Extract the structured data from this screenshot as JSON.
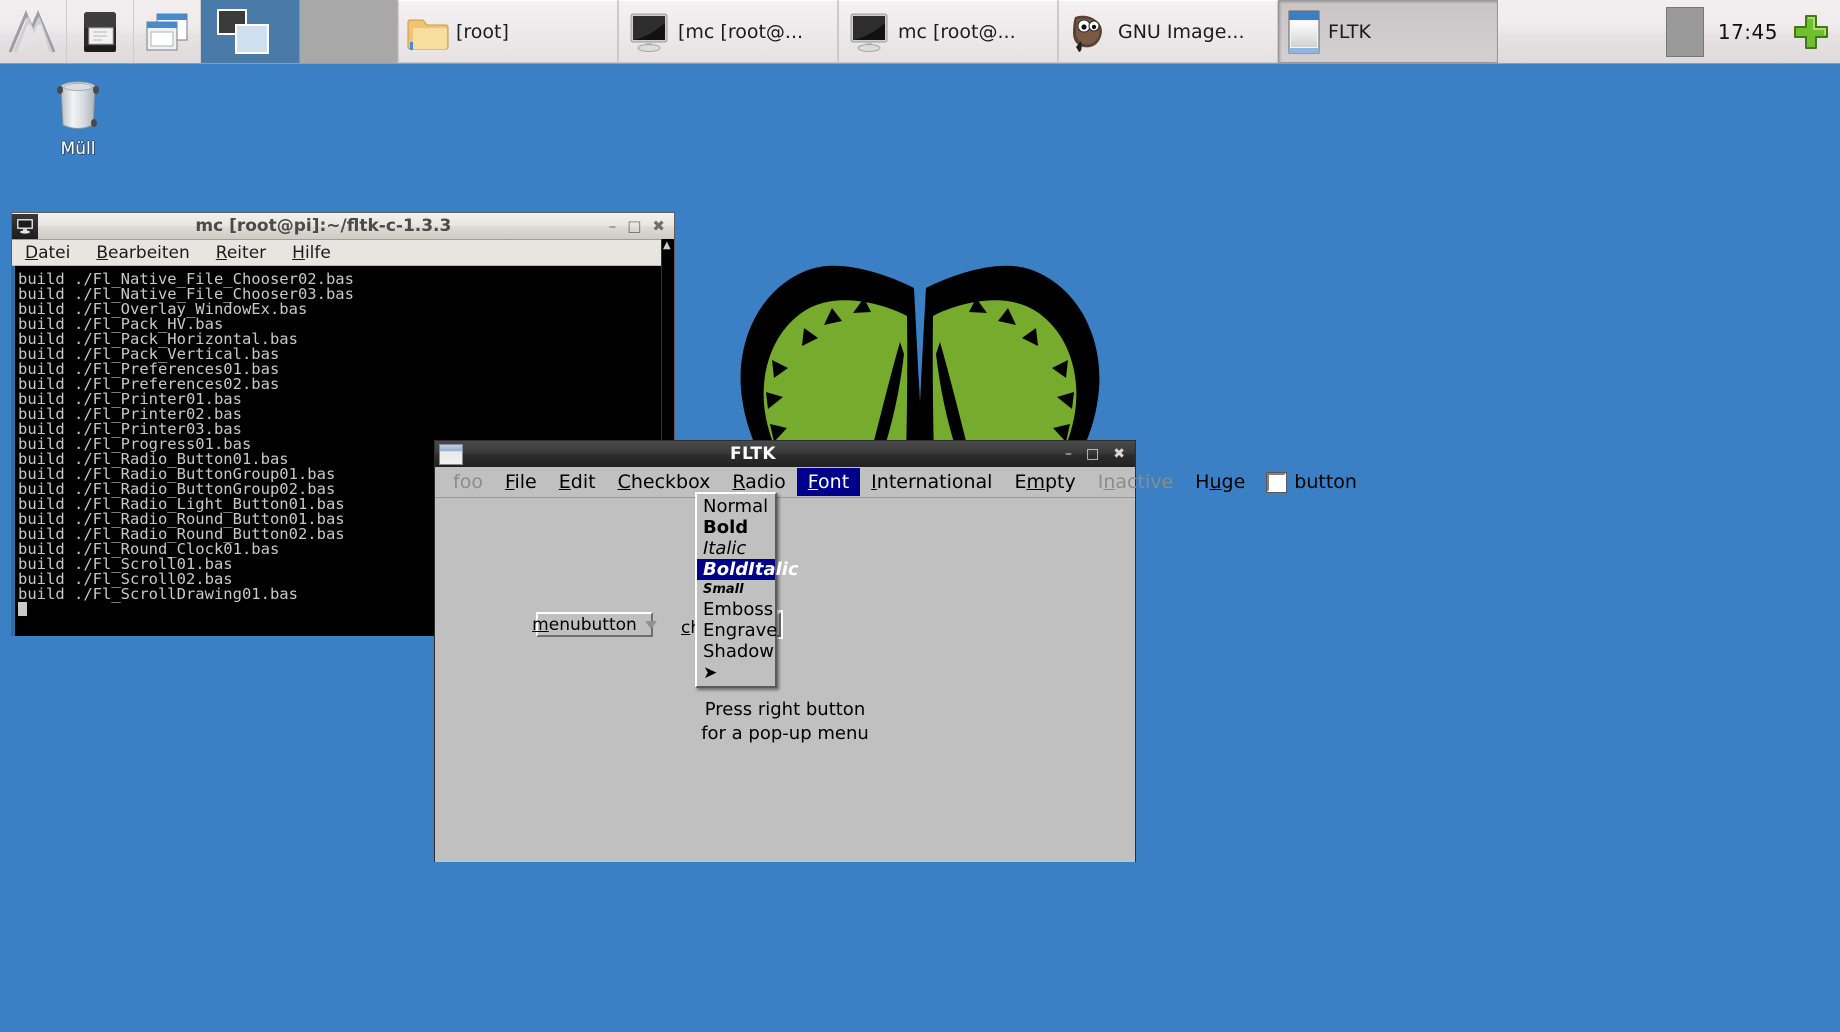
{
  "taskbar": {
    "launchers": [
      {
        "name": "xpaint-icon",
        "title": "XPaint"
      },
      {
        "name": "printer-icon",
        "title": "Printer"
      },
      {
        "name": "windows-icon",
        "title": "Windows"
      }
    ],
    "pager": {
      "active_desktop": 1,
      "desktops": 2
    },
    "tasks": [
      {
        "label": "[root]",
        "icon": "folder-icon",
        "state": "raised"
      },
      {
        "label": "[mc [root@...",
        "icon": "monitor-icon",
        "state": "raised"
      },
      {
        "label": "mc [root@...",
        "icon": "monitor-icon",
        "state": "raised"
      },
      {
        "label": "GNU Image...",
        "icon": "gimp-icon",
        "state": "raised"
      },
      {
        "label": "FLTK",
        "icon": "fltk-window-icon",
        "state": "pressed"
      }
    ],
    "clock": "17:45",
    "tray_add_icon": "green-plus-icon"
  },
  "desktop": {
    "background_color": "#3b80c4",
    "icons": [
      {
        "name": "trash-icon",
        "label": "Müll"
      }
    ],
    "wallpaper_logo": "two-green-leaves"
  },
  "mc_window": {
    "title": "mc [root@pi]:~/fltk-c-1.3.3",
    "icon": "terminal-icon",
    "window_buttons": [
      "minimize",
      "maximize",
      "close"
    ],
    "menu": [
      "Datei",
      "Bearbeiten",
      "Reiter",
      "Hilfe"
    ],
    "terminal_lines": [
      "build ./Fl_Native_File_Chooser02.bas",
      "build ./Fl_Native_File_Chooser03.bas",
      "build ./Fl_Overlay_WindowEx.bas",
      "build ./Fl_Pack_HV.bas",
      "build ./Fl_Pack_Horizontal.bas",
      "build ./Fl_Pack_Vertical.bas",
      "build ./Fl_Preferences01.bas",
      "build ./Fl_Preferences02.bas",
      "build ./Fl_Printer01.bas",
      "build ./Fl_Printer02.bas",
      "build ./Fl_Printer03.bas",
      "build ./Fl_Progress01.bas",
      "build ./Fl_Radio_Button01.bas",
      "build ./Fl_Radio_ButtonGroup01.bas",
      "build ./Fl_Radio_ButtonGroup02.bas",
      "build ./Fl_Radio_Light_Button01.bas",
      "build ./Fl_Radio_Round_Button01.bas",
      "build ./Fl_Radio_Round_Button02.bas",
      "build ./Fl_Round_Clock01.bas",
      "build ./Fl_Scroll01.bas",
      "build ./Fl_Scroll02.bas",
      "build ./Fl_ScrollDrawing01.bas"
    ]
  },
  "fltk_window": {
    "title": "FLTK",
    "window_buttons": [
      "minimize",
      "maximize",
      "close"
    ],
    "menubar": [
      {
        "label": "foo",
        "state": "disabled"
      },
      {
        "label": "File",
        "mnemonic": "F",
        "state": "normal"
      },
      {
        "label": "Edit",
        "mnemonic": "E",
        "state": "normal"
      },
      {
        "label": "Checkbox",
        "mnemonic": "C",
        "state": "normal"
      },
      {
        "label": "Radio",
        "mnemonic": "R",
        "state": "normal"
      },
      {
        "label": "Font",
        "mnemonic": "F",
        "state": "selected"
      },
      {
        "label": "International",
        "mnemonic": "I",
        "state": "normal"
      },
      {
        "label": "Empty",
        "mnemonic": "m",
        "state": "normal"
      },
      {
        "label": "Inactive",
        "mnemonic": "n",
        "state": "disabled"
      },
      {
        "label": "Huge",
        "mnemonic": "u",
        "state": "normal"
      },
      {
        "label": "button",
        "type": "checkbox",
        "checked": false
      }
    ],
    "menubutton": {
      "label": "menubutton",
      "mnemonic": "m"
    },
    "choice": {
      "label": "choice",
      "mnemonic": "c",
      "value": ""
    },
    "hint_line1": "Press right button",
    "hint_line2": "for a pop-up menu",
    "font_menu": {
      "items": [
        {
          "label": "Normal",
          "style": "normal",
          "selected": false
        },
        {
          "label": "Bold",
          "style": "bold",
          "selected": false
        },
        {
          "label": "Italic",
          "style": "italic",
          "selected": false
        },
        {
          "label": "BoldItalic",
          "style": "bolditalic",
          "selected": true
        },
        {
          "label": "Small",
          "style": "small",
          "selected": false
        },
        {
          "label": "Emboss",
          "style": "normal",
          "selected": false
        },
        {
          "label": "Engrave",
          "style": "normal",
          "selected": false
        },
        {
          "label": "Shadow",
          "style": "normal",
          "selected": false
        },
        {
          "label": "➤",
          "style": "arrow",
          "selected": false
        }
      ]
    }
  },
  "colors": {
    "desktop_blue": "#3b80c4",
    "menu_highlight": "#00008b",
    "fltk_face": "#c0c0c0",
    "leaf_green": "#76ab2e",
    "taskbar_bg": "#efeaec"
  }
}
